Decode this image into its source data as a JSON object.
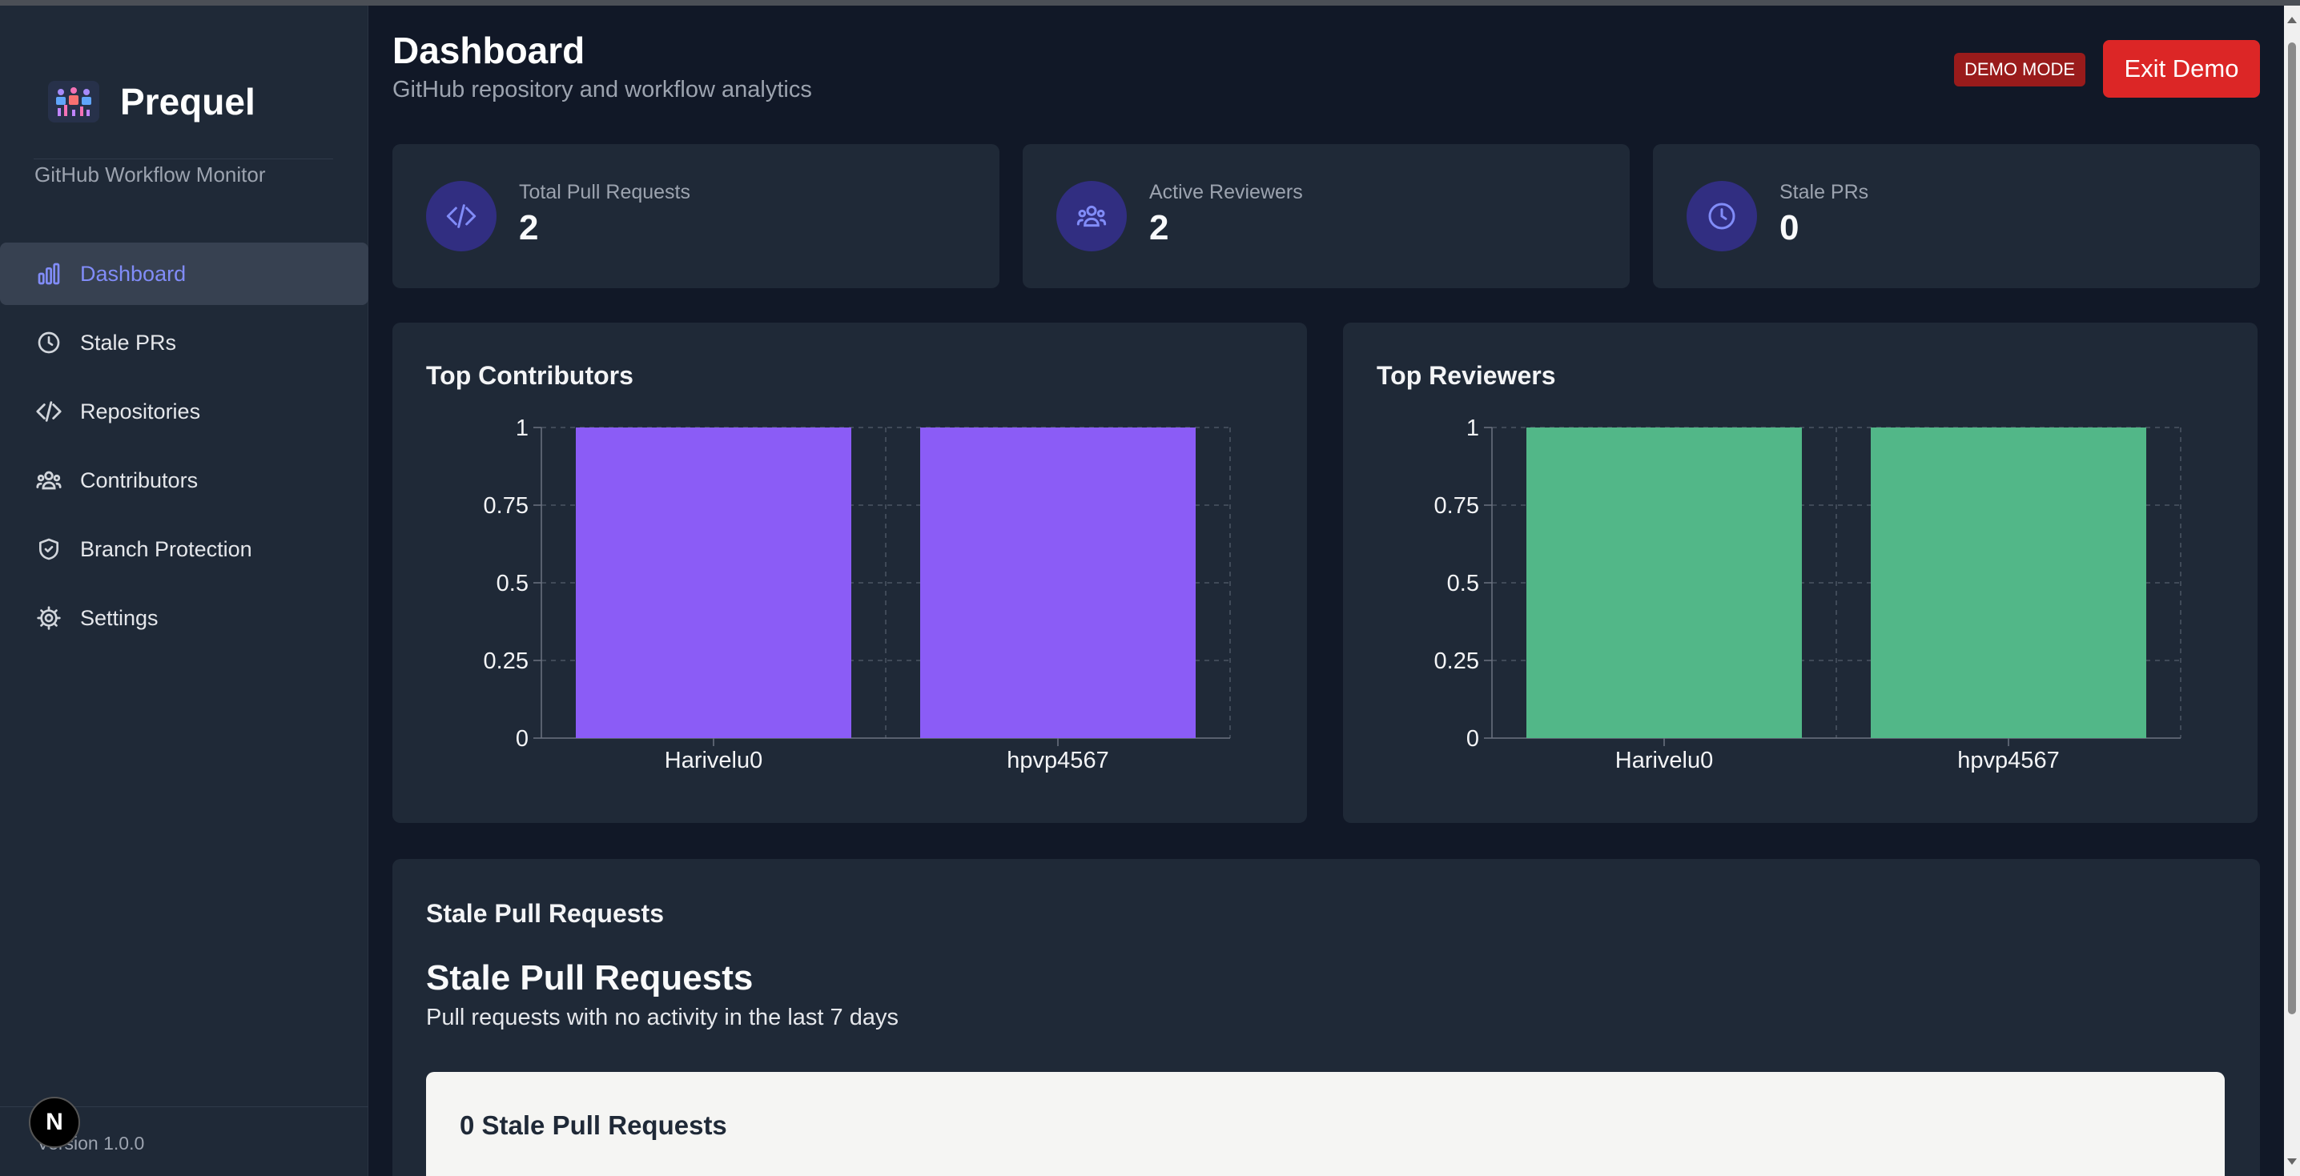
{
  "app": {
    "name": "Prequel",
    "subtitle": "GitHub Workflow Monitor",
    "version": "Version 1.0.0",
    "badge_letter": "N"
  },
  "sidebar": {
    "items": [
      {
        "label": "Dashboard",
        "icon": "bar-chart-icon",
        "active": true
      },
      {
        "label": "Stale PRs",
        "icon": "clock-icon",
        "active": false
      },
      {
        "label": "Repositories",
        "icon": "code-icon",
        "active": false
      },
      {
        "label": "Contributors",
        "icon": "users-icon",
        "active": false
      },
      {
        "label": "Branch Protection",
        "icon": "shield-icon",
        "active": false
      },
      {
        "label": "Settings",
        "icon": "gear-icon",
        "active": false
      }
    ]
  },
  "header": {
    "title": "Dashboard",
    "subtitle": "GitHub repository and workflow analytics",
    "demo_badge": "DEMO MODE",
    "exit_label": "Exit Demo"
  },
  "stats": [
    {
      "label": "Total Pull Requests",
      "value": "2",
      "icon": "code-icon"
    },
    {
      "label": "Active Reviewers",
      "value": "2",
      "icon": "users-icon"
    },
    {
      "label": "Stale PRs",
      "value": "0",
      "icon": "clock-icon"
    }
  ],
  "chart_data": [
    {
      "type": "bar",
      "title": "Top Contributors",
      "categories": [
        "Harivelu0",
        "hpvp4567"
      ],
      "values": [
        1,
        1
      ],
      "ylim": [
        0,
        1
      ],
      "yticks": [
        "0",
        "0.25",
        "0.5",
        "0.75",
        "1"
      ],
      "xlabel": "",
      "ylabel": "",
      "grid": true,
      "color": "#8b5cf6"
    },
    {
      "type": "bar",
      "title": "Top Reviewers",
      "categories": [
        "Harivelu0",
        "hpvp4567"
      ],
      "values": [
        1,
        1
      ],
      "ylim": [
        0,
        1
      ],
      "yticks": [
        "0",
        "0.25",
        "0.5",
        "0.75",
        "1"
      ],
      "xlabel": "",
      "ylabel": "",
      "grid": true,
      "color": "#52b788"
    }
  ],
  "stale": {
    "section_heading": "Stale Pull Requests",
    "title": "Stale Pull Requests",
    "description": "Pull requests with no activity in the last 7 days",
    "count_label": "0 Stale Pull Requests"
  },
  "colors": {
    "background": "#111827",
    "panel": "#1f2937",
    "accent": "#818cf8",
    "danger": "#dc2626"
  }
}
